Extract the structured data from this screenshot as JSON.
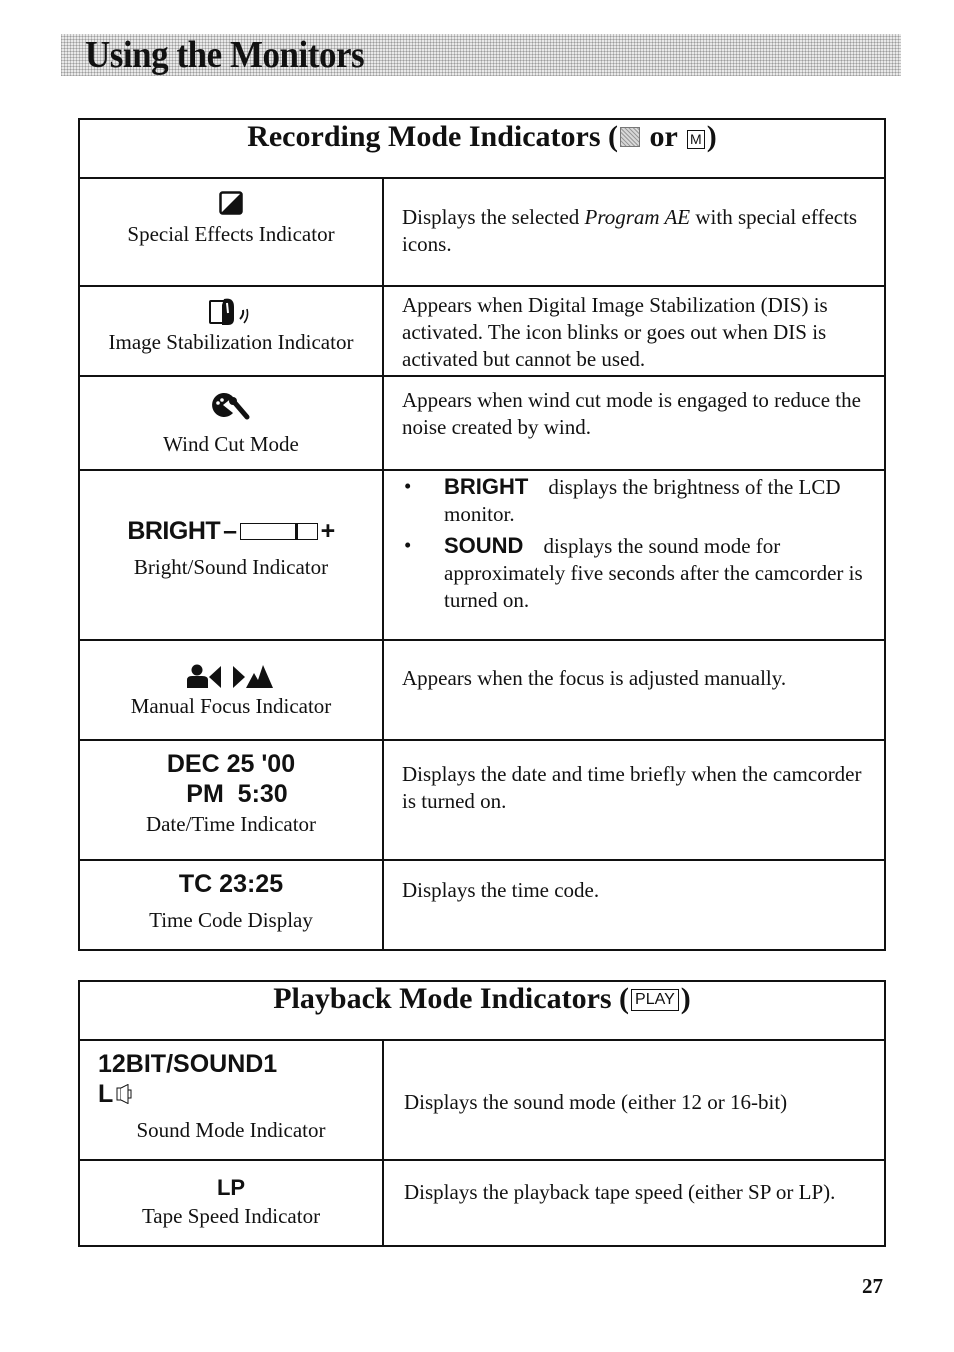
{
  "page": {
    "section_title": "Using the Monitors",
    "page_number": "27"
  },
  "recording": {
    "title_prefix": "Recording Mode Indicators (",
    "title_or": " or ",
    "title_suffix": ")",
    "mode_m_label": "M",
    "rows": [
      {
        "icon": "special-effects-icon",
        "caption": "Special Effects Indicator",
        "desc_pre": "Displays the selected ",
        "desc_italic": "Program AE",
        "desc_post": " with special effects icons."
      },
      {
        "icon": "image-stabilization-icon",
        "caption": "Image Stabilization Indicator",
        "desc": "Appears when Digital Image Stabilization (DIS) is activated. The icon blinks or goes out when DIS is activated but cannot be used."
      },
      {
        "icon": "wind-cut-icon",
        "caption": "Wind Cut Mode",
        "desc": "Appears when wind cut mode is engaged to reduce the noise created by wind."
      },
      {
        "display_label": "BRIGHT",
        "minus": "–",
        "plus": "+",
        "level_fraction": 0.72,
        "caption": "Bright/Sound Indicator",
        "bullets": [
          {
            "keyword": "BRIGHT",
            "text": "displays the brightness of the LCD monitor."
          },
          {
            "keyword": "SOUND",
            "text": "displays the sound mode for approximately five seconds after the camcorder is turned on."
          }
        ]
      },
      {
        "icon": "manual-focus-icon",
        "caption": "Manual Focus Indicator",
        "desc": "Appears when the focus is adjusted manually."
      },
      {
        "display_line1": "DEC 25 '00",
        "display_line2": "PM  5:30",
        "caption": "Date/Time Indicator",
        "desc": "Displays the date and time briefly when the camcorder is turned on."
      },
      {
        "display_line1": "TC 23:25",
        "caption": "Time Code Display",
        "desc": "Displays the time code."
      }
    ]
  },
  "playback": {
    "title_prefix": "Playback Mode Indicators (",
    "title_box": "PLAY",
    "title_suffix": ")",
    "rows": [
      {
        "display_line1": "12BIT/SOUND1",
        "display_line2": "L",
        "icon": "speaker-icon",
        "caption": "Sound Mode Indicator",
        "desc": "Displays the sound mode (either 12 or 16-bit)"
      },
      {
        "display_line1": "LP",
        "caption": "Tape Speed Indicator",
        "desc": "Displays the playback tape speed (either SP or LP)."
      }
    ]
  },
  "bullet_glyph": "•"
}
